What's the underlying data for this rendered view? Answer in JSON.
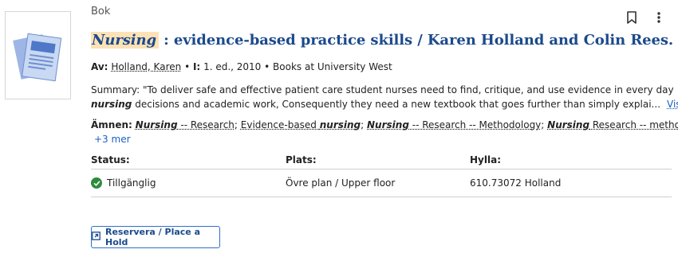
{
  "record": {
    "format": "Bok",
    "title_highlight": "Nursing",
    "title_rest": " : evidence-based practice skills / Karen Holland and Colin Rees.",
    "meta": {
      "author_label": "Av:",
      "author": "Holland, Karen",
      "edition_label": "I:",
      "edition": "1. ed., 2010",
      "location": "Books at University West"
    },
    "summary": {
      "label": "Summary:",
      "line1": "\"To deliver safe and effective patient care student nurses need to find, critique, and use evidence in every day",
      "line2_highlight": "nursing",
      "line2_rest": " decisions and academic work, Consequently they need a new textbook that goes further than simply explai...",
      "more": "Visa mer"
    },
    "subjects": {
      "label": "Ämnen:",
      "items": [
        {
          "hl": "Nursing",
          "rest": " -- Research"
        },
        {
          "hl": "",
          "pre": "Evidence-based ",
          "hl2": "nursing",
          "rest": ""
        },
        {
          "hl": "Nursing",
          "rest": " -- Research -- Methodology"
        },
        {
          "hl": "Nursing",
          "rest": " Research -- methods"
        }
      ],
      "more": "+3 mer"
    },
    "holdings": {
      "headers": [
        "Status:",
        "Plats:",
        "Hylla:"
      ],
      "rows": [
        {
          "status": "Tillgänglig",
          "location": "Övre plan / Upper floor",
          "shelf": "610.73072 Holland"
        }
      ]
    },
    "hold_button": "Reservera / Place a Hold",
    "icons": {
      "bookmark": "bookmark-icon",
      "more": "more-vertical-icon",
      "available": "check-circle-icon",
      "external": "external-link-icon"
    },
    "colors": {
      "title": "#1b4a8c",
      "highlight": "#fde2b6",
      "link": "#1b5fc1",
      "available": "#2e8b3d"
    }
  }
}
